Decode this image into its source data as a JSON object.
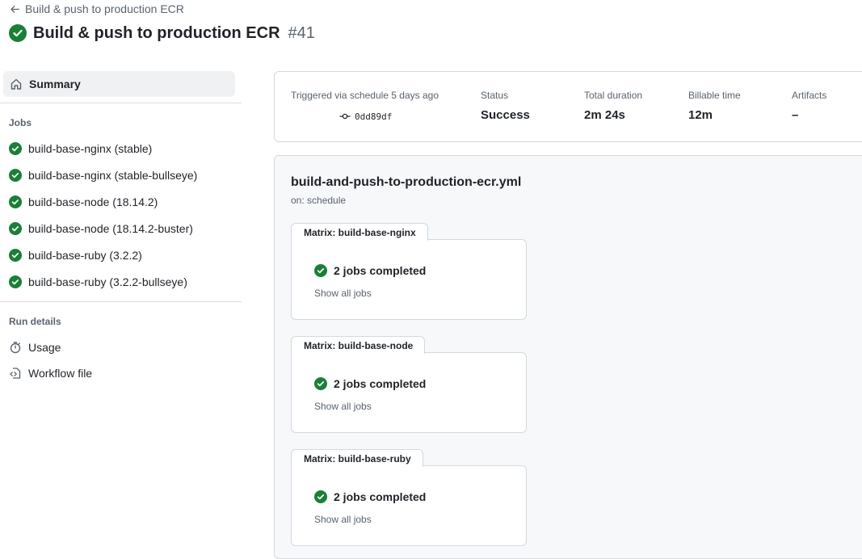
{
  "header": {
    "back_label": "Build & push to production ECR",
    "title": "Build & push to production ECR",
    "run_number": "#41",
    "status_color": "#1a7f37"
  },
  "sidebar": {
    "summary_label": "Summary",
    "jobs_heading": "Jobs",
    "jobs": [
      {
        "label": "build-base-nginx (stable)"
      },
      {
        "label": "build-base-nginx (stable-bullseye)"
      },
      {
        "label": "build-base-node (18.14.2)"
      },
      {
        "label": "build-base-node (18.14.2-buster)"
      },
      {
        "label": "build-base-ruby (3.2.2)"
      },
      {
        "label": "build-base-ruby (3.2.2-bullseye)"
      }
    ],
    "run_details_heading": "Run details",
    "details": [
      {
        "label": "Usage",
        "icon": "stopwatch-icon"
      },
      {
        "label": "Workflow file",
        "icon": "workflow-file-icon"
      }
    ]
  },
  "summary": {
    "trigger_text": "Triggered via schedule 5 days ago",
    "commit": "0dd89df",
    "status_label": "Status",
    "status_value": "Success",
    "duration_label": "Total duration",
    "duration_value": "2m 24s",
    "billable_label": "Billable time",
    "billable_value": "12m",
    "artifacts_label": "Artifacts",
    "artifacts_value": "–"
  },
  "workflow": {
    "file_name": "build-and-push-to-production-ecr.yml",
    "trigger": "on: schedule",
    "matrices": [
      {
        "title": "Matrix: build-base-nginx",
        "status": "2 jobs completed",
        "show_all": "Show all jobs"
      },
      {
        "title": "Matrix: build-base-node",
        "status": "2 jobs completed",
        "show_all": "Show all jobs"
      },
      {
        "title": "Matrix: build-base-ruby",
        "status": "2 jobs completed",
        "show_all": "Show all jobs"
      }
    ]
  }
}
